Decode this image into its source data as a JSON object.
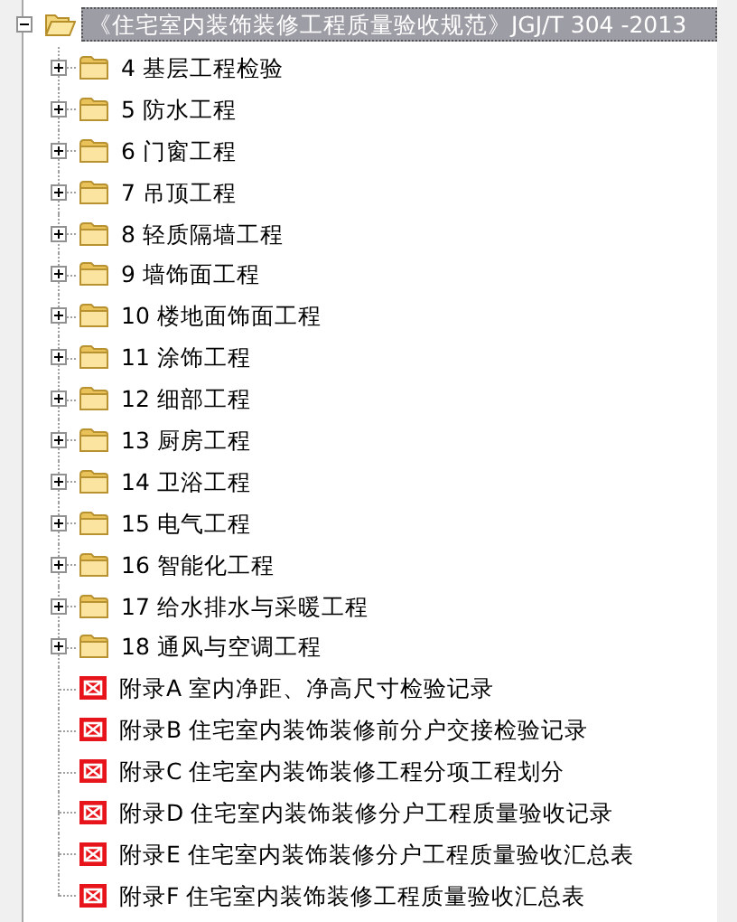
{
  "tree": {
    "label": "《住宅室内装饰装修工程质量验收规范》JGJ/T 304 -2013",
    "kind": "folder",
    "expanded": true,
    "selected": true,
    "children": [
      {
        "label": "4 基层工程检验",
        "kind": "folder",
        "expanded": false,
        "selected": false
      },
      {
        "label": "5 防水工程",
        "kind": "folder",
        "expanded": false,
        "selected": false
      },
      {
        "label": "6 门窗工程",
        "kind": "folder",
        "expanded": false,
        "selected": false
      },
      {
        "label": "7 吊顶工程",
        "kind": "folder",
        "expanded": false,
        "selected": false
      },
      {
        "label": "8 轻质隔墙工程",
        "kind": "folder",
        "expanded": false,
        "selected": false
      },
      {
        "label": "9 墙饰面工程",
        "kind": "folder",
        "expanded": false,
        "selected": false
      },
      {
        "label": "10 楼地面饰面工程",
        "kind": "folder",
        "expanded": false,
        "selected": false
      },
      {
        "label": "11 涂饰工程",
        "kind": "folder",
        "expanded": false,
        "selected": false
      },
      {
        "label": "12 细部工程",
        "kind": "folder",
        "expanded": false,
        "selected": false
      },
      {
        "label": "13 厨房工程",
        "kind": "folder",
        "expanded": false,
        "selected": false
      },
      {
        "label": "14 卫浴工程",
        "kind": "folder",
        "expanded": false,
        "selected": false
      },
      {
        "label": "15 电气工程",
        "kind": "folder",
        "expanded": false,
        "selected": false
      },
      {
        "label": "16 智能化工程",
        "kind": "folder",
        "expanded": false,
        "selected": false
      },
      {
        "label": "17 给水排水与采暖工程",
        "kind": "folder",
        "expanded": false,
        "selected": false
      },
      {
        "label": "18 通风与空调工程",
        "kind": "folder",
        "expanded": false,
        "selected": false
      },
      {
        "label": "附录A 室内净距、净高尺寸检验记录",
        "kind": "document",
        "selected": false
      },
      {
        "label": "附录B 住宅室内装饰装修前分户交接检验记录",
        "kind": "document",
        "selected": false
      },
      {
        "label": "附录C 住宅室内装饰装修工程分项工程划分",
        "kind": "document",
        "selected": false
      },
      {
        "label": "附录D 住宅室内装饰装修分户工程质量验收记录",
        "kind": "document",
        "selected": false
      },
      {
        "label": "附录E 住宅室内装饰装修分户工程质量验收汇总表",
        "kind": "document",
        "selected": false
      },
      {
        "label": "附录F 住宅室内装饰装修工程质量验收汇总表",
        "kind": "document",
        "selected": false
      }
    ]
  }
}
